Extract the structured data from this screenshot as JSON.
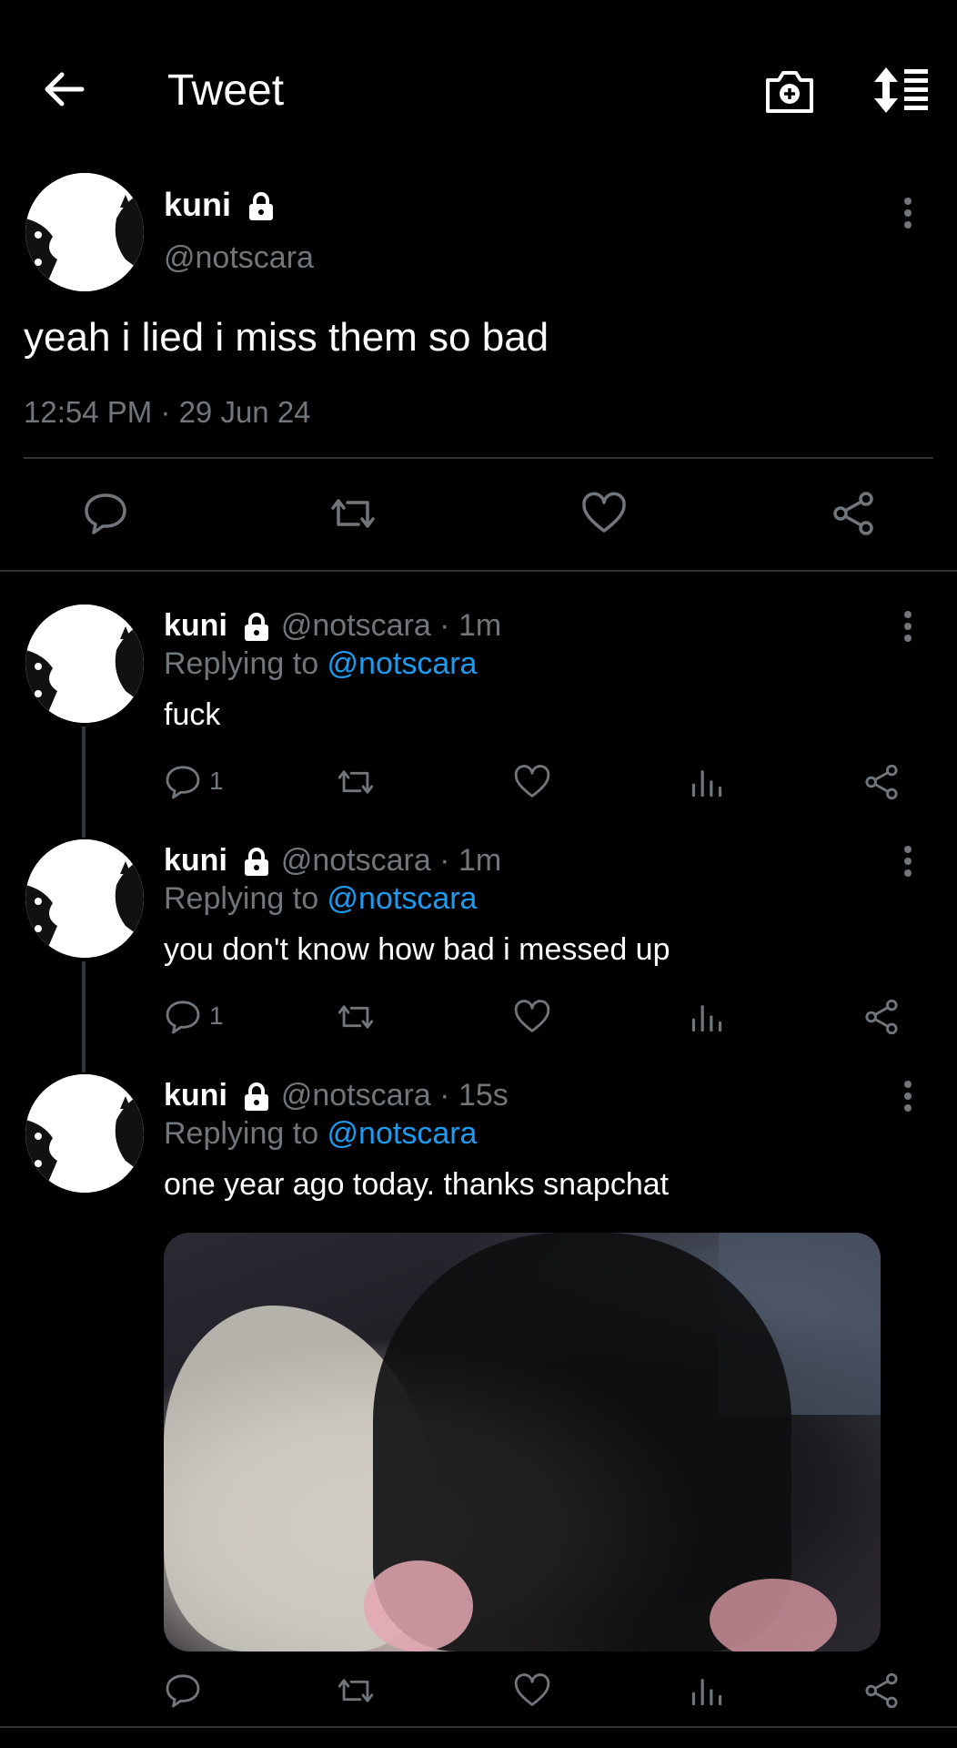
{
  "header": {
    "title": "Tweet"
  },
  "main_tweet": {
    "name": "kuni",
    "handle": "@notscara",
    "text": "yeah i lied i miss them so bad",
    "timestamp": "12:54 PM · 29 Jun 24"
  },
  "replies": [
    {
      "name": "kuni",
      "meta": "@notscara · 1m",
      "replying_label": "Replying to ",
      "replying_to": "@notscara",
      "text": "fuck",
      "reply_count": "1"
    },
    {
      "name": "kuni",
      "meta": "@notscara · 1m",
      "replying_label": "Replying to ",
      "replying_to": "@notscara",
      "text": "you don't know how bad i messed up",
      "reply_count": "1"
    },
    {
      "name": "kuni",
      "meta": "@notscara · 15s",
      "replying_label": "Replying to ",
      "replying_to": "@notscara",
      "text": "one year ago today. thanks snapchat",
      "reply_count": ""
    }
  ],
  "colors": {
    "background": "#000000",
    "muted": "#71767b",
    "mention": "#1d9bf0",
    "divider": "#2f3336"
  }
}
